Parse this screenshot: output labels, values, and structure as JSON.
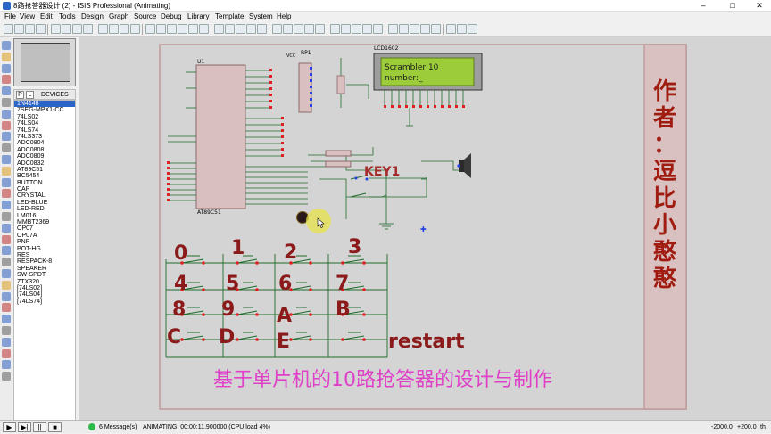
{
  "window": {
    "title": "8路抢答器设计 (2) - ISIS Professional (Animating)",
    "minimize": "–",
    "maximize": "□",
    "close": "✕"
  },
  "menu": [
    "File",
    "View",
    "Edit",
    "Tools",
    "Design",
    "Graph",
    "Source",
    "Debug",
    "Library",
    "Template",
    "System",
    "Help"
  ],
  "sidebar": {
    "tab_p": "P",
    "tab_l": "L",
    "header": "DEVICES",
    "devices": [
      "1N4148",
      "7SEG-MPX1-CC",
      "74LS02",
      "74LS04",
      "74LS74",
      "74LS373",
      "ADC0804",
      "ADC0808",
      "ADC0809",
      "ADC0832",
      "AT89C51",
      "BC5454",
      "BUTTON",
      "CAP",
      "CRYSTAL",
      "LED-BLUE",
      "LED-RED",
      "LM016L",
      "MMBT2369",
      "OP07",
      "OP07A",
      "PNP",
      "POT-HG",
      "RES",
      "RESPACK-8",
      "SPEAKER",
      "SW-SPDT",
      "ZTX320",
      "[74LS02]",
      "[74LS04]",
      "[74LS74]"
    ],
    "selected": 0
  },
  "schematic": {
    "u1_label": "U1",
    "u1_type": "AT89C51",
    "rp1_label": "RP1",
    "lcd_label": "LCD1602",
    "lcd_line1": "Scrambler 10",
    "lcd_line2": "number:_",
    "key1_label": "KEY1",
    "vcc_label": "VCC",
    "author": "作者：逗比小憨憨",
    "bottom_title": "基于单片机的10路抢答器的设计与制作",
    "restart": "restart",
    "button_labels": [
      "0",
      "1",
      "2",
      "3",
      "4",
      "5",
      "6",
      "7",
      "8",
      "9",
      "A",
      "B",
      "C",
      "D",
      "E"
    ],
    "colors": {
      "wire": "#1f6b2a",
      "label": "#a52a2a",
      "title": "#e040c8",
      "chip": "#d9bfbf",
      "frame": "#d0a9a9",
      "lcd": "#9ccc3a"
    }
  },
  "status": {
    "messages": "6 Message(s)",
    "state": "ANIMATING: 00:00:11.900000 (CPU load 4%)",
    "coord_x": "-2000.0",
    "coord_y": "+200.0",
    "zoom": "th"
  }
}
